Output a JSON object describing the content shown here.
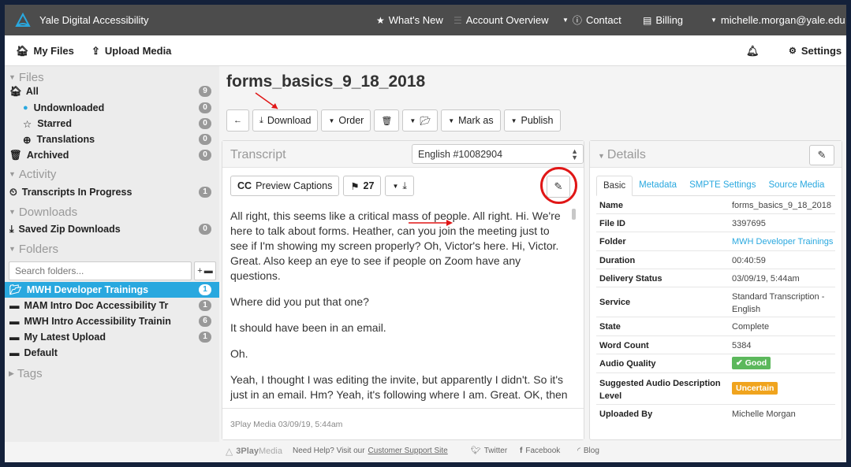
{
  "topnav": {
    "brand": "Yale Digital Accessibility",
    "whats_new": "What's New",
    "account_overview": "Account Overview",
    "contact": "Contact",
    "billing": "Billing",
    "user": "michelle.morgan@yale.edu"
  },
  "subnav": {
    "my_files": "My Files",
    "upload_media": "Upload Media",
    "settings": "Settings"
  },
  "sidebar": {
    "files_head": "Files",
    "all": {
      "label": "All",
      "count": "9"
    },
    "undownloaded": {
      "label": "Undownloaded",
      "count": "0"
    },
    "starred": {
      "label": "Starred",
      "count": "0"
    },
    "translations": {
      "label": "Translations",
      "count": "0"
    },
    "archived": {
      "label": "Archived",
      "count": "0"
    },
    "activity_head": "Activity",
    "transcripts": {
      "label": "Transcripts In Progress",
      "count": "1"
    },
    "downloads_head": "Downloads",
    "saved_zip": {
      "label": "Saved Zip Downloads",
      "count": "0"
    },
    "folders_head": "Folders",
    "search_placeholder": "Search folders...",
    "add_label": "+",
    "folders": [
      {
        "label": "MWH Developer Trainings",
        "count": "1"
      },
      {
        "label": "MAM Intro Doc Accessibility Tr",
        "count": "1"
      },
      {
        "label": "MWH Intro Accessibility Trainin",
        "count": "6"
      },
      {
        "label": "My Latest Upload",
        "count": "1"
      },
      {
        "label": "Default",
        "count": ""
      }
    ],
    "tags_head": "Tags"
  },
  "main": {
    "title": "forms_basics_9_18_2018",
    "buttons": {
      "download": "Download",
      "order": "Order",
      "mark_as": "Mark as",
      "publish": "Publish"
    }
  },
  "transcript": {
    "title": "Transcript",
    "language": "English #10082904",
    "cc_bold": "CC",
    "cc_label": "Preview Captions",
    "flag_count": "27",
    "paragraphs": [
      "All right, this seems like a critical mass of people. All right. Hi. We're here to talk about forms. Heather, can you join the meeting just to see if I'm showing my screen properly? Oh, Victor's here. Hi, Victor. Great. Also keep an eye to see if people on Zoom have any questions.",
      "Where did you put that one?",
      "It should have been in an email.",
      "Oh.",
      "Yeah, I thought I was editing the invite, but apparently I didn't. So it's just in an email. Hm? Yeah, it's following where I am. Great. OK, then we'll get started. We're recording. I won't put--"
    ],
    "footer": "3Play Media 03/09/19, 5:44am"
  },
  "details": {
    "title": "Details",
    "tabs": [
      "Basic",
      "Metadata",
      "SMPTE Settings",
      "Source Media"
    ],
    "rows": [
      {
        "label": "Name",
        "value": "forms_basics_9_18_2018"
      },
      {
        "label": "File ID",
        "value": "3397695"
      },
      {
        "label": "Folder",
        "value": "MWH Developer Trainings"
      },
      {
        "label": "Duration",
        "value": "00:40:59"
      },
      {
        "label": "Delivery Status",
        "value": "03/09/19, 5:44am"
      },
      {
        "label": "Service",
        "value": "Standard Transcription - English"
      },
      {
        "label": "State",
        "value": "Complete"
      },
      {
        "label": "Word Count",
        "value": "5384"
      },
      {
        "label": "Audio Quality",
        "value": "Good"
      },
      {
        "label": "Suggested Audio Description Level",
        "value": "Uncertain"
      },
      {
        "label": "Uploaded By",
        "value": "Michelle Morgan"
      }
    ]
  },
  "footer": {
    "logo_bold": "3Play",
    "logo_light": "Media",
    "help": "Need Help? Visit our",
    "support_link": "Customer Support Site",
    "twitter": "Twitter",
    "facebook": "Facebook",
    "blog": "Blog"
  },
  "colors": {
    "accent": "#29a8df",
    "good": "#5cb85c",
    "uncertain": "#f0a41e",
    "annotation": "#e01616"
  }
}
